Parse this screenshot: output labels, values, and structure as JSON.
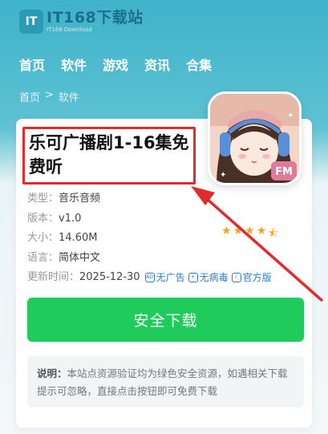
{
  "logo": {
    "mark": "IT",
    "name": "IT168下载站",
    "sub": "IT168 Download"
  },
  "nav": [
    "首页",
    "软件",
    "游戏",
    "资讯",
    "合集"
  ],
  "breadcrumb": {
    "home": "首页",
    "sep": ">",
    "current": "软件"
  },
  "app": {
    "title": "乐可广播剧1-16集免费听",
    "icon_badge": "FM",
    "type_label": "类型：",
    "type_value": "音乐音频",
    "version_label": "版本：",
    "version_value": "v1.0",
    "size_label": "大小：",
    "size_value": "14.60M",
    "lang_label": "语言：",
    "lang_value": "简体中文",
    "updated_label": "更新时间：",
    "updated_value": "2025-12-30",
    "badge_noad": "无广告",
    "badge_novirus": "无病毒",
    "badge_official": "官方版",
    "rating_stars": 4.5
  },
  "download": {
    "label": "安全下载"
  },
  "notice": {
    "label": "说明：",
    "text": "本站点资源验证均为绿色安全资源，如遇相关下载提示可忽略，直接点击按钮即可免费下载"
  },
  "colors": {
    "accent": "#1fcc5b",
    "highlight": "#e02c2c",
    "link": "#2f7dc9"
  }
}
